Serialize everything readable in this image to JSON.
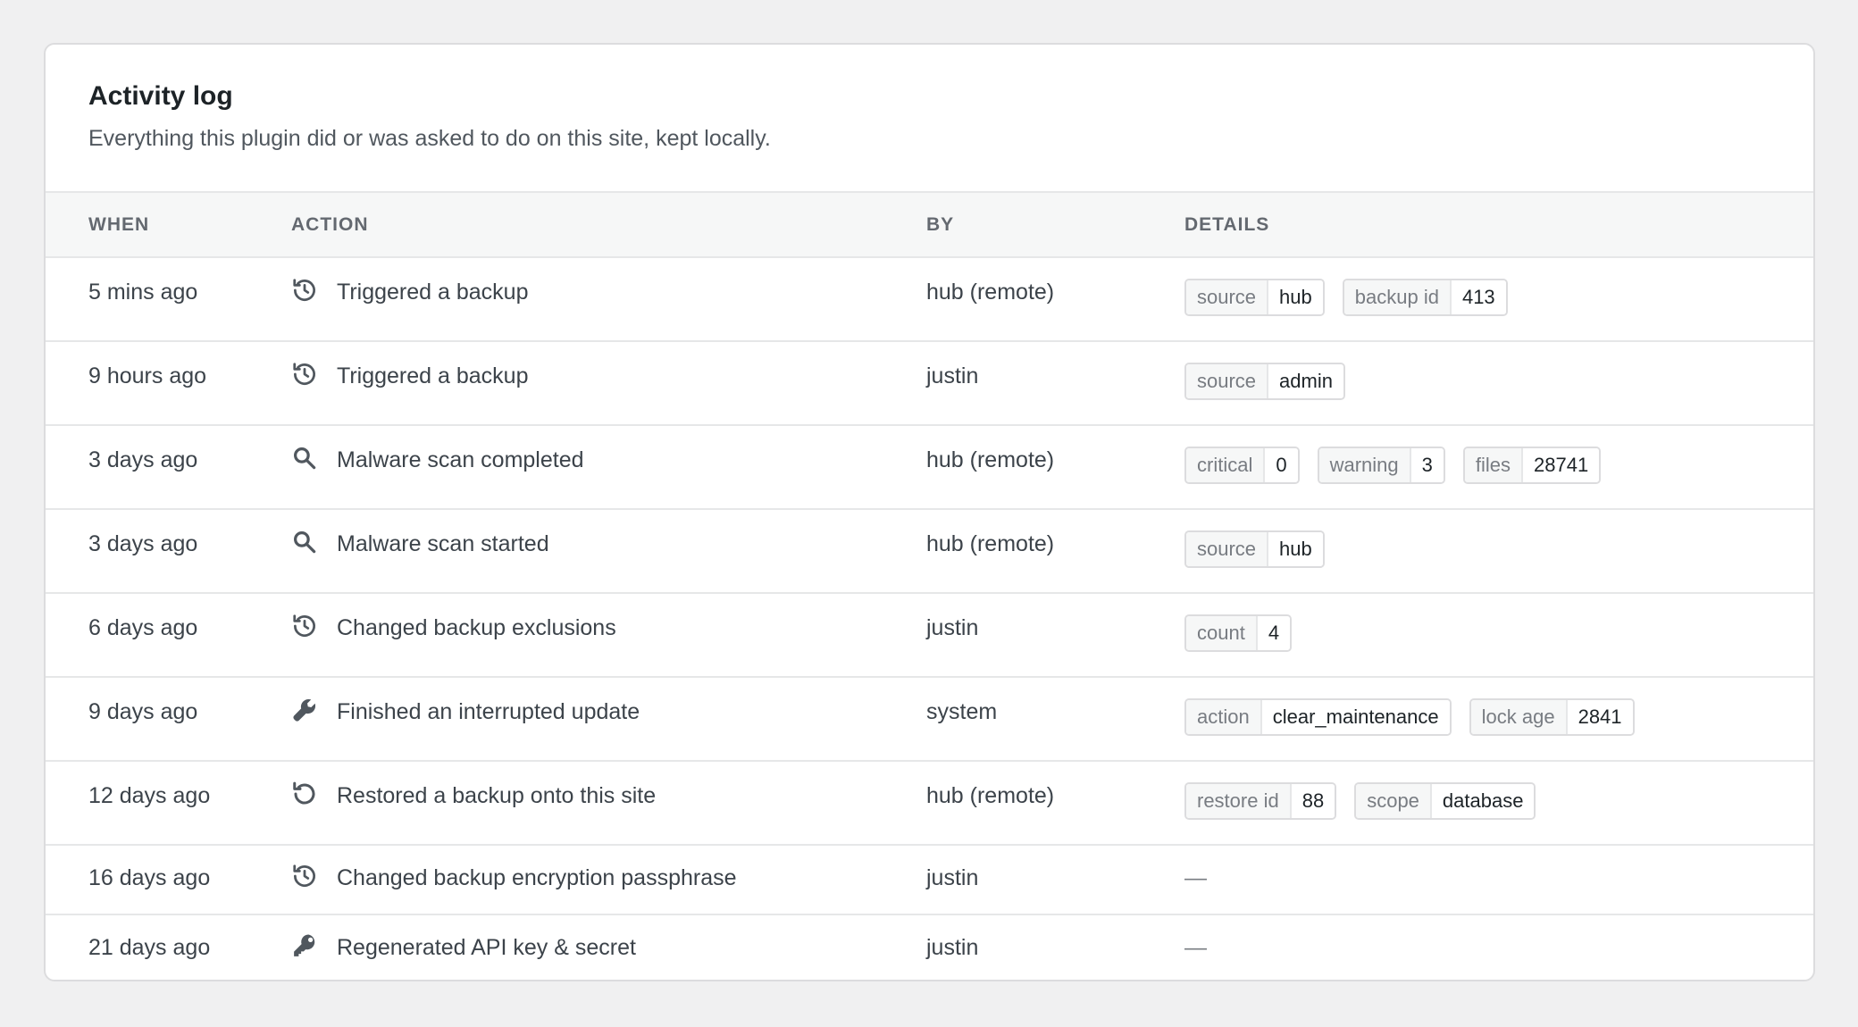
{
  "header": {
    "title": "Activity log",
    "subtitle": "Everything this plugin did or was asked to do on this site, kept locally."
  },
  "columns": {
    "when": "WHEN",
    "action": "ACTION",
    "by": "BY",
    "details": "DETAILS"
  },
  "empty_details": "—",
  "rows": [
    {
      "when": "5 mins ago",
      "icon": "history-icon",
      "action": "Triggered a backup",
      "by": "hub (remote)",
      "details": [
        {
          "k": "source",
          "v": "hub"
        },
        {
          "k": "backup id",
          "v": "413"
        }
      ]
    },
    {
      "when": "9 hours ago",
      "icon": "history-icon",
      "action": "Triggered a backup",
      "by": "justin",
      "details": [
        {
          "k": "source",
          "v": "admin"
        }
      ]
    },
    {
      "when": "3 days ago",
      "icon": "search-icon",
      "action": "Malware scan completed",
      "by": "hub (remote)",
      "details": [
        {
          "k": "critical",
          "v": "0"
        },
        {
          "k": "warning",
          "v": "3"
        },
        {
          "k": "files",
          "v": "28741"
        }
      ]
    },
    {
      "when": "3 days ago",
      "icon": "search-icon",
      "action": "Malware scan started",
      "by": "hub (remote)",
      "details": [
        {
          "k": "source",
          "v": "hub"
        }
      ]
    },
    {
      "when": "6 days ago",
      "icon": "history-icon",
      "action": "Changed backup exclusions",
      "by": "justin",
      "details": [
        {
          "k": "count",
          "v": "4"
        }
      ]
    },
    {
      "when": "9 days ago",
      "icon": "wrench-icon",
      "action": "Finished an interrupted update",
      "by": "system",
      "details": [
        {
          "k": "action",
          "v": "clear_maintenance"
        },
        {
          "k": "lock age",
          "v": "2841"
        }
      ]
    },
    {
      "when": "12 days ago",
      "icon": "restore-icon",
      "action": "Restored a backup onto this site",
      "by": "hub (remote)",
      "details": [
        {
          "k": "restore id",
          "v": "88"
        },
        {
          "k": "scope",
          "v": "database"
        }
      ]
    },
    {
      "when": "16 days ago",
      "icon": "history-icon",
      "action": "Changed backup encryption passphrase",
      "by": "justin",
      "details": []
    },
    {
      "when": "21 days ago",
      "icon": "key-icon",
      "action": "Regenerated API key & secret",
      "by": "justin",
      "details": []
    }
  ]
}
